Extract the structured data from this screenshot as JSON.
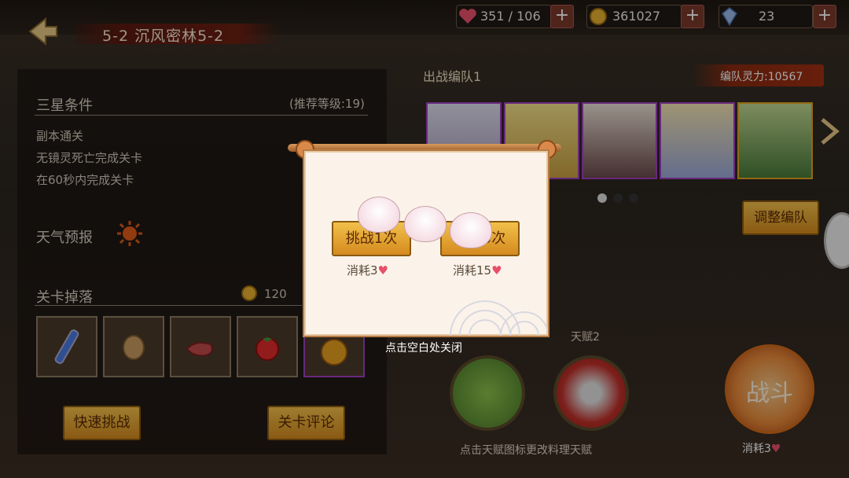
{
  "header": {
    "stage_title": "5-2 沉风密林5-2",
    "stamina": "351 / 106",
    "coins": "361027",
    "gems": "23"
  },
  "left_panel": {
    "three_star_title": "三星条件",
    "recommended_level": "(推荐等级:19)",
    "conditions": [
      "副本通关",
      "无镜灵死亡完成关卡",
      "在60秒内完成关卡"
    ],
    "weather_label": "天气预报",
    "drops_title": "关卡掉落",
    "drop_coin": "120",
    "quick_challenge_label": "快速挑战",
    "stage_review_label": "关卡评论"
  },
  "team": {
    "title": "出战编队1",
    "power": "编队灵力:10567",
    "adjust_label": "调整编队"
  },
  "talents": {
    "talent2_label": "天赋2",
    "hint": "点击天赋图标更改料理天赋"
  },
  "fight": {
    "label": "战斗",
    "cost": "消耗3"
  },
  "popup": {
    "challenge_once_label": "挑战1次",
    "cost_once": "消耗3",
    "challenge_multi_label": "挑战5次",
    "cost_multi": "消耗15",
    "close_hint": "点击空白处关闭"
  },
  "colors": {
    "gold_button": "#f2c04a",
    "panel_border": "#b57b45",
    "accent_red": "#c0392b"
  }
}
